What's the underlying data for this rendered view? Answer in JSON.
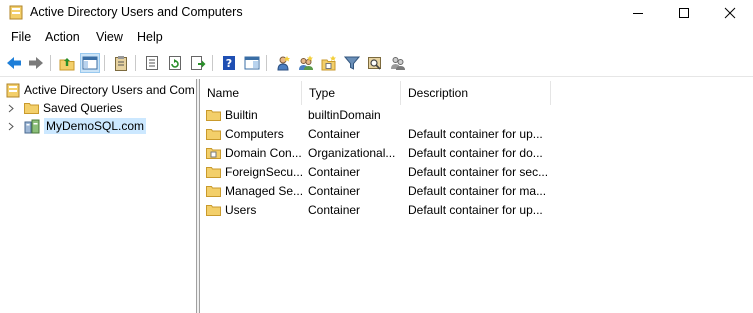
{
  "window": {
    "title": "Active Directory Users and Computers"
  },
  "menu": [
    "File",
    "Action",
    "View",
    "Help"
  ],
  "tree": {
    "root_label": "Active Directory Users and Com",
    "items": [
      {
        "label": "Saved Queries"
      },
      {
        "label": "MyDemoSQL.com"
      }
    ]
  },
  "list": {
    "columns": [
      "Name",
      "Type",
      "Description"
    ],
    "rows": [
      {
        "name": "Builtin",
        "type": "builtinDomain",
        "description": ""
      },
      {
        "name": "Computers",
        "type": "Container",
        "description": "Default container for up..."
      },
      {
        "name": "Domain Con...",
        "type": "Organizational...",
        "description": "Default container for do..."
      },
      {
        "name": "ForeignSecu...",
        "type": "Container",
        "description": "Default container for sec..."
      },
      {
        "name": "Managed Se...",
        "type": "Container",
        "description": "Default container for ma..."
      },
      {
        "name": "Users",
        "type": "Container",
        "description": "Default container for up..."
      }
    ]
  },
  "colors": {
    "folder_fill": "#f3cf6a",
    "folder_edge": "#c99a2c",
    "selection": "#cce8ff",
    "back_arrow": "#1f7fd8",
    "forward_arrow": "#7a7a7a"
  },
  "icons": {
    "toolbar": [
      "back-arrow-icon",
      "forward-arrow-icon",
      "up-folder-icon",
      "show-hide-tree-icon",
      "clipboard-icon",
      "properties-icon",
      "refresh-icon",
      "export-list-icon",
      "help-icon",
      "console-tree-icon",
      "new-user-icon",
      "new-group-icon",
      "new-ou-icon",
      "filter-icon",
      "find-icon",
      "add-to-group-icon"
    ]
  }
}
